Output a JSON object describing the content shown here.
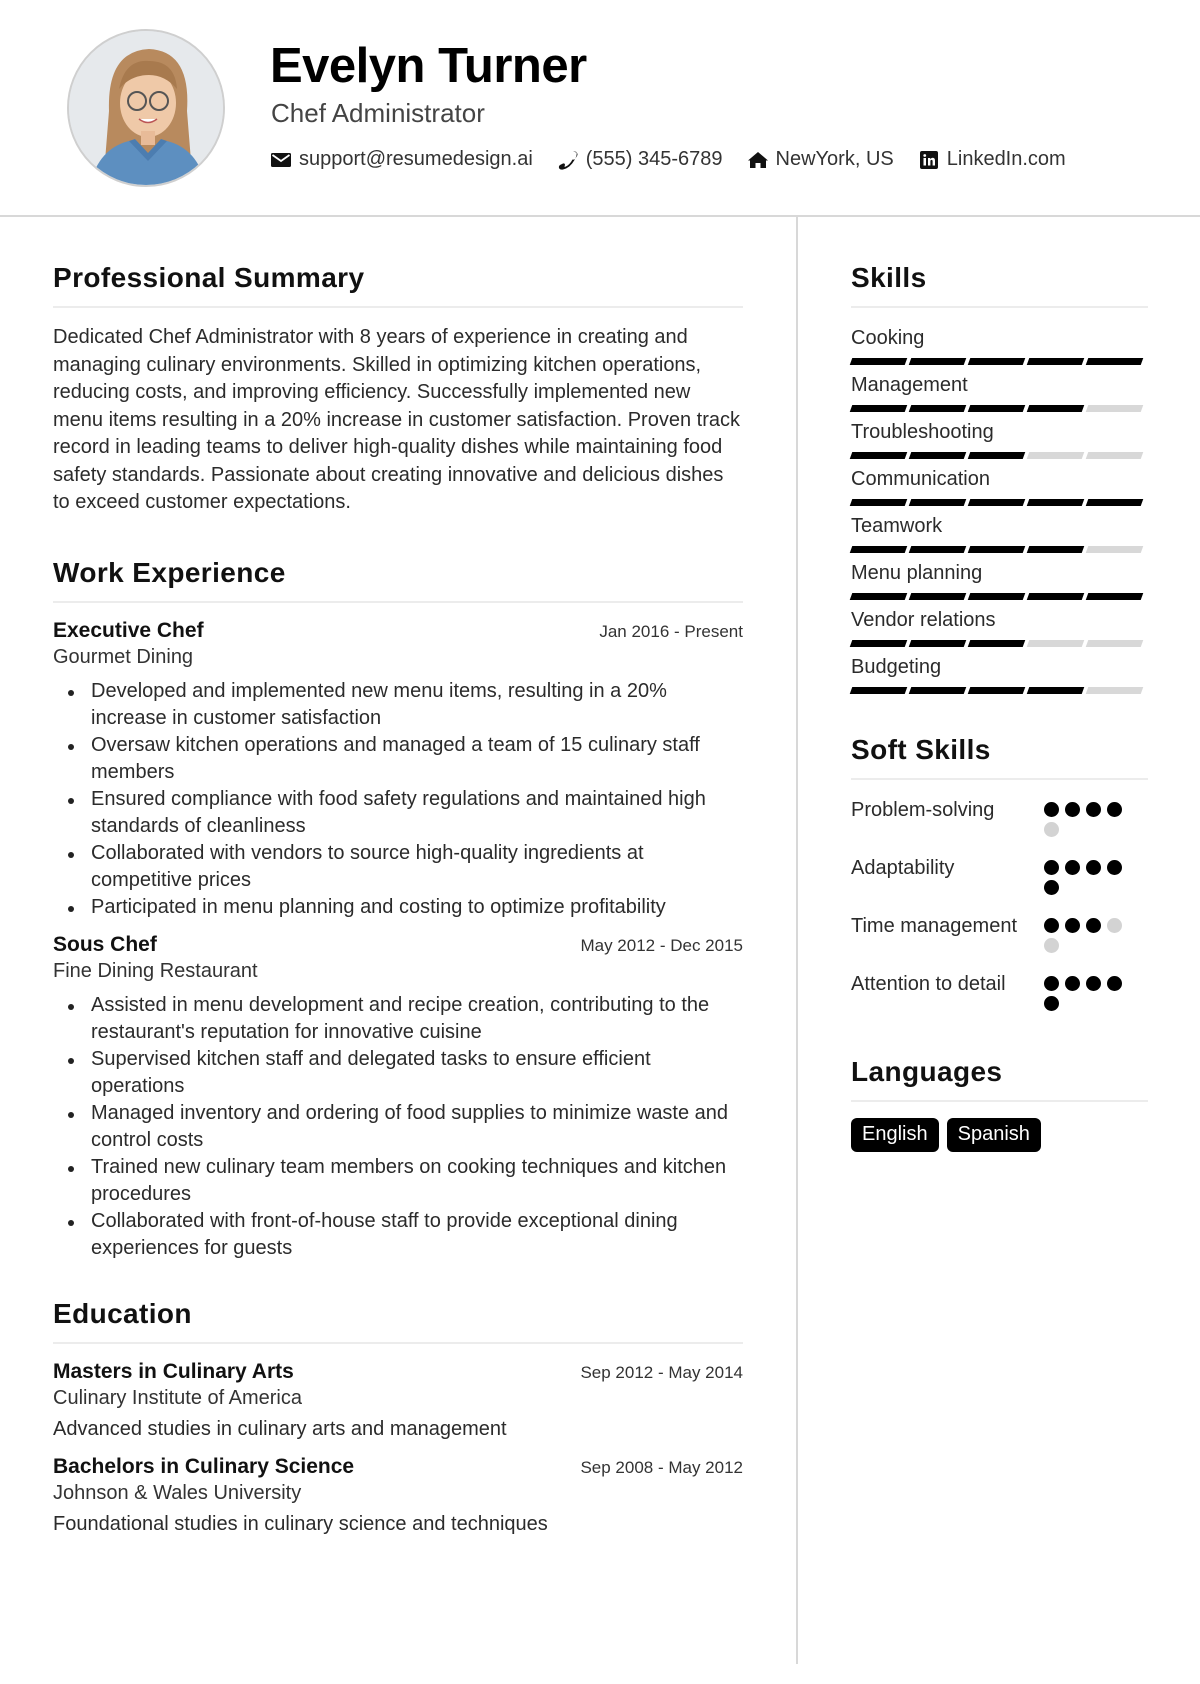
{
  "header": {
    "name": "Evelyn Turner",
    "title": "Chef Administrator",
    "contacts": [
      {
        "icon": "envelope-icon",
        "text": "support@resumedesign.ai"
      },
      {
        "icon": "phone-icon",
        "text": "(555) 345-6789"
      },
      {
        "icon": "home-icon",
        "text": "NewYork, US"
      },
      {
        "icon": "linkedin-icon",
        "text": "LinkedIn.com"
      }
    ]
  },
  "summary": {
    "heading": "Professional Summary",
    "text": "Dedicated Chef Administrator with 8 years of experience in creating and managing culinary environments. Skilled in optimizing kitchen operations, reducing costs, and improving efficiency. Successfully implemented new menu items resulting in a 20% increase in customer satisfaction. Proven track record in leading teams to deliver high-quality dishes while maintaining food safety standards. Passionate about creating innovative and delicious dishes to exceed customer expectations."
  },
  "experience": {
    "heading": "Work Experience",
    "jobs": [
      {
        "role": "Executive Chef",
        "dates": "Jan 2016 - Present",
        "company": "Gourmet Dining",
        "bullets": [
          "Developed and implemented new menu items, resulting in a 20% increase in customer satisfaction",
          "Oversaw kitchen operations and managed a team of 15 culinary staff members",
          "Ensured compliance with food safety regulations and maintained high standards of cleanliness",
          "Collaborated with vendors to source high-quality ingredients at competitive prices",
          "Participated in menu planning and costing to optimize profitability"
        ]
      },
      {
        "role": "Sous Chef",
        "dates": "May 2012 - Dec 2015",
        "company": "Fine Dining Restaurant",
        "bullets": [
          "Assisted in menu development and recipe creation, contributing to the restaurant's reputation for innovative cuisine",
          "Supervised kitchen staff and delegated tasks to ensure efficient operations",
          "Managed inventory and ordering of food supplies to minimize waste and control costs",
          "Trained new culinary team members on cooking techniques and kitchen procedures",
          "Collaborated with front-of-house staff to provide exceptional dining experiences for guests"
        ]
      }
    ]
  },
  "education": {
    "heading": "Education",
    "items": [
      {
        "degree": "Masters in Culinary Arts",
        "dates": "Sep 2012 - May 2014",
        "school": "Culinary Institute of America",
        "description": "Advanced studies in culinary arts and management"
      },
      {
        "degree": "Bachelors in Culinary Science",
        "dates": "Sep 2008 - May 2012",
        "school": "Johnson & Wales University",
        "description": "Foundational studies in culinary science and techniques"
      }
    ]
  },
  "skills": {
    "heading": "Skills",
    "max": 5,
    "items": [
      {
        "name": "Cooking",
        "level": 5
      },
      {
        "name": "Management",
        "level": 4
      },
      {
        "name": "Troubleshooting",
        "level": 3
      },
      {
        "name": "Communication",
        "level": 5
      },
      {
        "name": "Teamwork",
        "level": 4
      },
      {
        "name": "Menu planning",
        "level": 5
      },
      {
        "name": "Vendor relations",
        "level": 3
      },
      {
        "name": "Budgeting",
        "level": 4
      }
    ]
  },
  "soft_skills": {
    "heading": "Soft Skills",
    "max": 5,
    "items": [
      {
        "name": "Problem-solving",
        "level": 4
      },
      {
        "name": "Adaptability",
        "level": 5
      },
      {
        "name": "Time management",
        "level": 3
      },
      {
        "name": "Attention to detail",
        "level": 5
      }
    ]
  },
  "languages": {
    "heading": "Languages",
    "items": [
      "English",
      "Spanish"
    ]
  }
}
